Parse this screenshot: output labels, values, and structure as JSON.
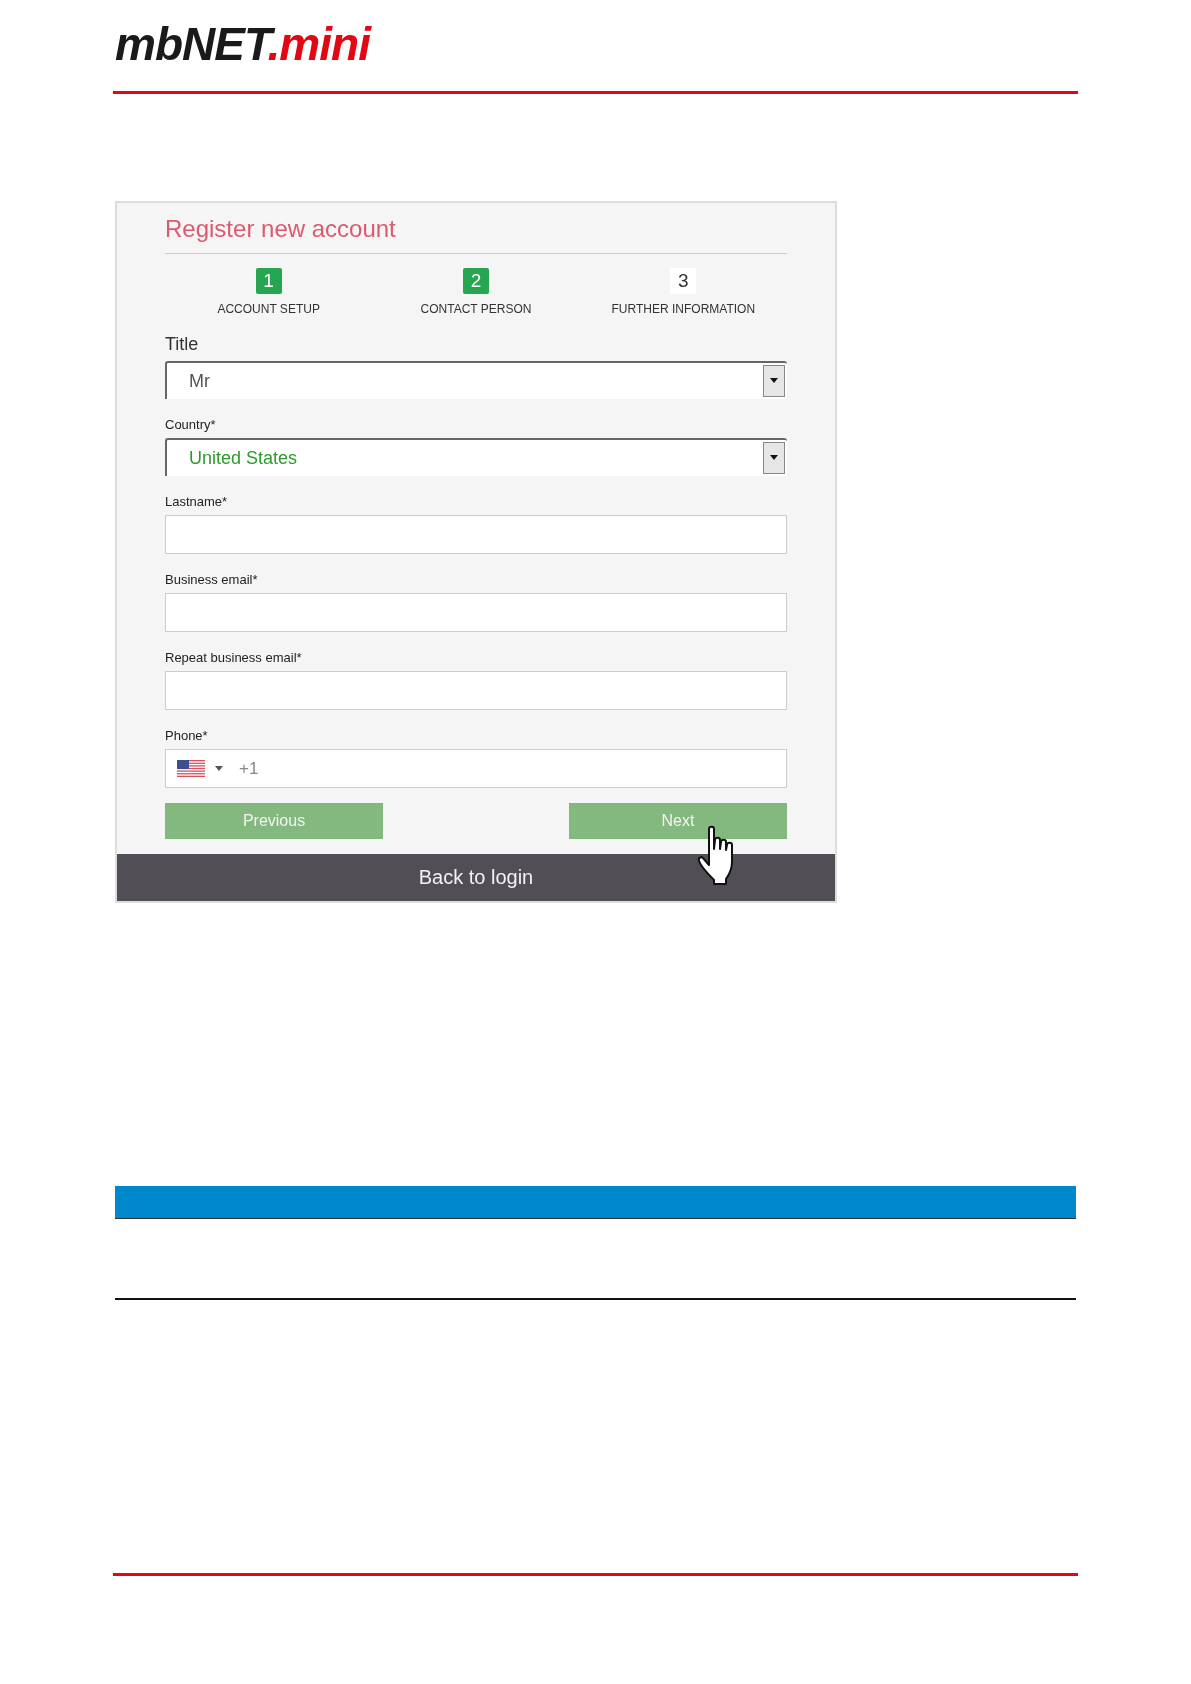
{
  "logo": {
    "main": "mbNET",
    "suffix": ".mini"
  },
  "form": {
    "title": "Register new account",
    "steps": [
      {
        "number": "1",
        "label": "ACCOUNT SETUP",
        "completed": true
      },
      {
        "number": "2",
        "label": "CONTACT PERSON",
        "completed": true
      },
      {
        "number": "3",
        "label": "FURTHER INFORMATION",
        "completed": false
      }
    ],
    "fields": [
      {
        "kind": "select",
        "label": "Title",
        "value": "Mr",
        "valid": false
      },
      {
        "kind": "select",
        "label": "Country*",
        "value": "United States",
        "valid": true
      },
      {
        "kind": "text",
        "label": "Lastname*"
      },
      {
        "kind": "text",
        "label": "Business email*"
      },
      {
        "kind": "text",
        "label": "Repeat business email*"
      },
      {
        "kind": "phone",
        "label": "Phone*",
        "placeholder": "+1"
      }
    ],
    "buttons": [
      "Previous",
      "Next"
    ],
    "footer_link": "Back to login"
  }
}
